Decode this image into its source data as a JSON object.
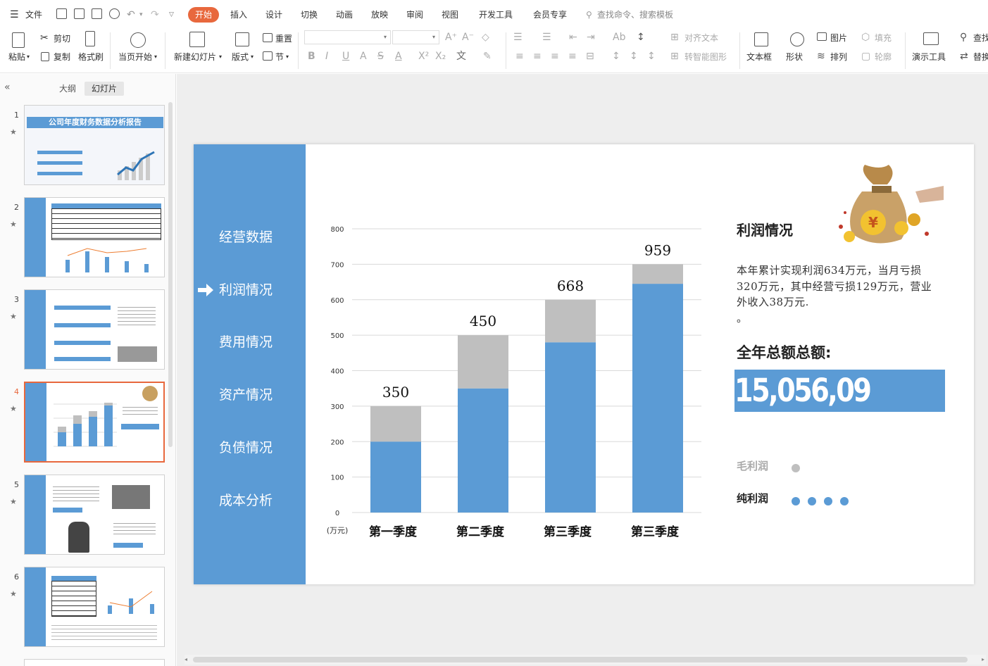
{
  "menu": {
    "file_label": "文件",
    "tabs": [
      "开始",
      "插入",
      "设计",
      "切换",
      "动画",
      "放映",
      "审阅",
      "视图",
      "开发工具",
      "会员专享"
    ],
    "search_placeholder": "查找命令、搜索模板"
  },
  "ribbon": {
    "paste": "粘贴",
    "cut": "剪切",
    "copy": "复制",
    "format_painter": "格式刷",
    "play_from_current": "当页开始",
    "new_slide": "新建幻灯片",
    "layout": "版式",
    "reset": "重置",
    "section": "节",
    "align_text": "对齐文本",
    "smart_graphic": "转智能图形",
    "textbox": "文本框",
    "shape": "形状",
    "picture": "图片",
    "fill": "填充",
    "arrange": "排列",
    "outline": "轮廓",
    "presentation_tools": "演示工具",
    "find": "查找",
    "replace": "替换"
  },
  "left_panel": {
    "tab_outline": "大纲",
    "tab_slides": "幻灯片",
    "slide_numbers": [
      "1",
      "2",
      "3",
      "4",
      "5",
      "6"
    ],
    "active_index": 4,
    "slide1_title": "公司年度财务数据分析报告"
  },
  "slide": {
    "nav_items": [
      "经营数据",
      "利润情况",
      "费用情况",
      "资产情况",
      "负债情况",
      "成本分析"
    ],
    "active_nav": "利润情况",
    "panel_title": "利润情况",
    "description": "本年累计实现利润634万元，当月亏损320万元，其中经营亏损129万元，营业外收入38万元.",
    "description_tail": "。",
    "total_label": "全年总额总额:",
    "total_value": "15,056,09",
    "legend": [
      {
        "label": "毛利润",
        "dots": 1,
        "color": "#bfbfbf"
      },
      {
        "label": "纯利润",
        "dots": 4,
        "color": "#5b9bd5"
      }
    ]
  },
  "chart_data": {
    "type": "bar",
    "stacked": true,
    "categories": [
      "第一季度",
      "第二季度",
      "第三季度",
      "第三季度"
    ],
    "series": [
      {
        "values": [
          200,
          350,
          480,
          645
        ],
        "color": "#5b9bd5"
      },
      {
        "values": [
          100,
          150,
          120,
          55
        ],
        "color": "#bfbfbf"
      }
    ],
    "data_labels": [
      "350",
      "450",
      "668",
      "959"
    ],
    "yticks": [
      0,
      100,
      200,
      300,
      400,
      500,
      600,
      700,
      800
    ],
    "ylim": [
      0,
      800
    ],
    "unit_label": "(万元)",
    "grid": true
  }
}
